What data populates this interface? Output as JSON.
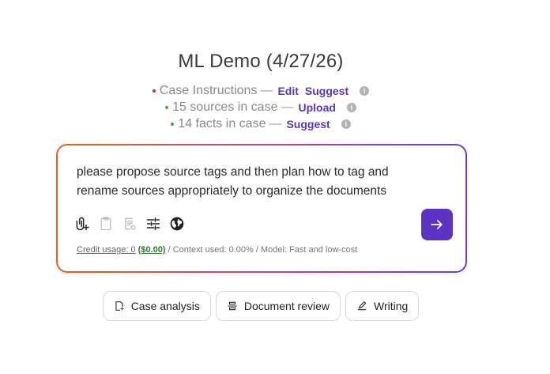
{
  "header": {
    "title": "ML Demo (4/27/26)"
  },
  "status": {
    "instructions": {
      "label": "Case Instructions",
      "dot_color": "#d62b2b",
      "separator": "—",
      "edit": "Edit",
      "suggest": "Suggest"
    },
    "sources": {
      "label": "15 sources in case",
      "dot_color": "#3fa34d",
      "separator": "—",
      "upload": "Upload"
    },
    "facts": {
      "label": "14 facts in case",
      "dot_color": "#3fa34d",
      "separator": "—",
      "suggest": "Suggest"
    }
  },
  "composer": {
    "prompt": "please propose source tags and then plan how to tag and rename sources appropriately to organize the documents",
    "tools": [
      "attach-icon",
      "clipboard-icon",
      "document-settings-icon",
      "sliders-icon",
      "globe-icon"
    ],
    "usage": {
      "credit_label": "Credit usage: 0",
      "credit_amount": "($0.00)",
      "rest": "/ Context used: 0.00% / Model: Fast and low-cost"
    },
    "accent": "#5b34c4"
  },
  "modes": [
    {
      "label": "Case analysis",
      "icon": "case-analysis-icon"
    },
    {
      "label": "Document review",
      "icon": "document-review-icon"
    },
    {
      "label": "Writing",
      "icon": "pencil-icon"
    }
  ]
}
